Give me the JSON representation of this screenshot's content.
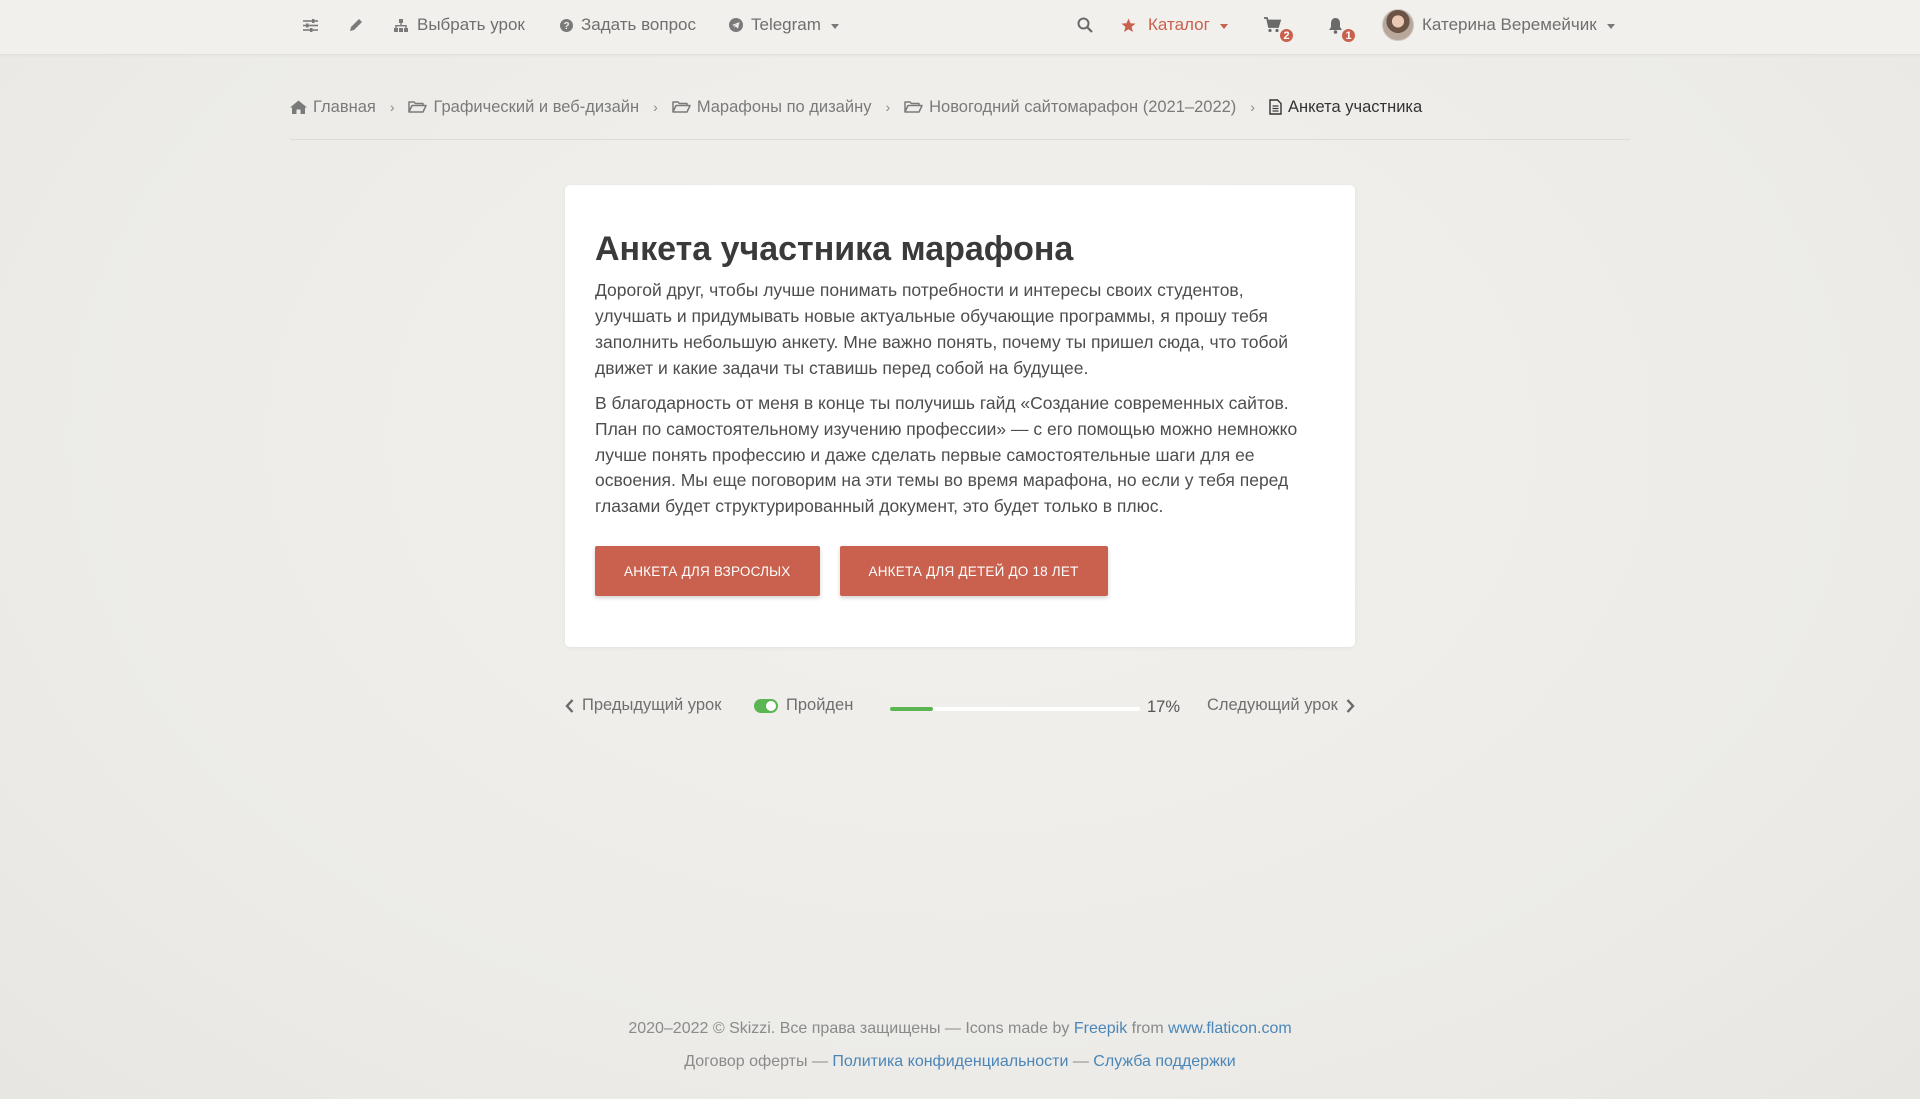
{
  "nav": {
    "choose_lesson": "Выбрать урок",
    "ask_question": "Задать вопрос",
    "telegram": "Telegram",
    "catalog": "Каталог",
    "cart_count": "2",
    "notifications_count": "1",
    "user_name": "Катерина Веремейчик"
  },
  "colors": {
    "accent": "#c9614e",
    "success": "#5ab552",
    "link": "#4a86b8"
  },
  "breadcrumb": {
    "home": "Главная",
    "items": [
      "Графический и веб-дизайн",
      "Марафоны по дизайну",
      "Новогодний сайтомарафон (2021–2022)"
    ],
    "current": "Анкета участника"
  },
  "card": {
    "title": "Анкета участника марафона",
    "paragraph1": "Дорогой друг, чтобы лучше понимать потребности и интересы своих студентов, улучшать и придумывать новые актуальные обучающие программы, я прошу тебя заполнить небольшую анкету. Мне важно понять, почему ты пришел сюда, что тобой движет и какие задачи ты ставишь перед собой на будущее.",
    "paragraph2": "В благодарность от меня в конце ты получишь гайд «Создание современных сайтов. План по самостоятельному изучению профессии» — с его помощью можно немножко лучше понять профессию и даже сделать первые самостоятельные шаги для ее освоения. Мы еще поговорим на эти темы во время марафона, но если у тебя перед глазами будет структурированный документ, это будет только в плюс.",
    "button_adults": "Анкета для взрослых",
    "button_kids": "Анкета для детей до 18 лет"
  },
  "lesson_nav": {
    "prev": "Предыдущий урок",
    "completed": "Пройден",
    "progress_text": "17%",
    "progress_value": 0.17,
    "next": "Следующий урок"
  },
  "footer": {
    "line1_prefix": "2020–2022 © Skizzi. Все права защищены — Icons made by ",
    "freepik": "Freepik",
    "from": " from ",
    "flaticon": "www.flaticon.com",
    "offer": "Договор оферты — ",
    "privacy": "Политика конфиденциальности",
    "dash": " — ",
    "support": "Служба поддержки"
  }
}
